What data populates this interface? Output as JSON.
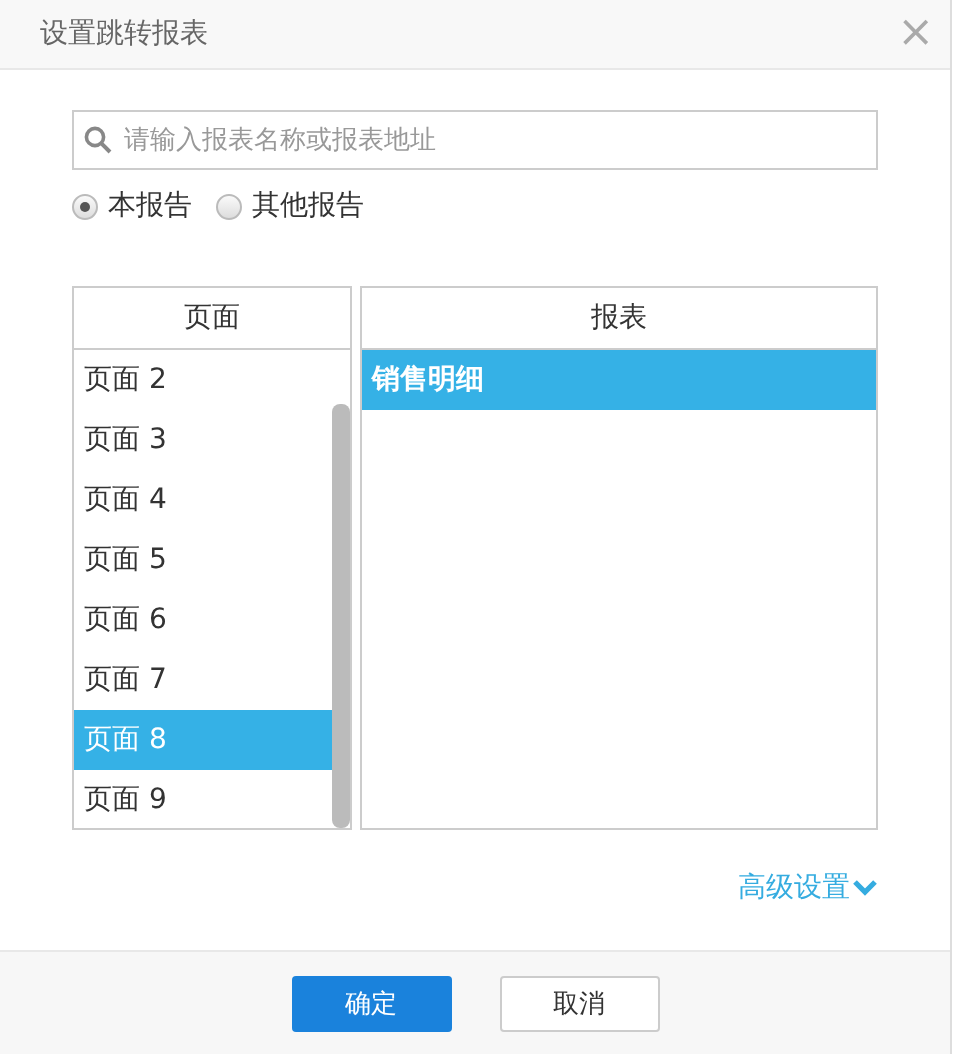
{
  "window": {
    "title": "设置跳转报表",
    "close": "×"
  },
  "search": {
    "placeholder": "请输入报表名称或报表地址"
  },
  "scope": [
    {
      "label": "本报告",
      "selected": true
    },
    {
      "label": "其他报告",
      "selected": false
    }
  ],
  "pages": {
    "heading": "页面",
    "items": [
      {
        "label": "页面 2",
        "selected": false
      },
      {
        "label": "页面 3",
        "selected": false
      },
      {
        "label": "页面 4",
        "selected": false
      },
      {
        "label": "页面 5",
        "selected": false
      },
      {
        "label": "页面 6",
        "selected": false
      },
      {
        "label": "页面 7",
        "selected": false
      },
      {
        "label": "页面 8",
        "selected": true
      },
      {
        "label": "页面 9",
        "selected": false
      }
    ]
  },
  "reports": {
    "heading": "报表",
    "items": [
      {
        "label": "销售明细",
        "selected": true
      }
    ]
  },
  "advanced": {
    "label": "高级设置",
    "expanded": false
  },
  "buttons": [
    {
      "label": "确定",
      "kind": "primary"
    },
    {
      "label": "取消",
      "kind": "secondary"
    }
  ]
}
